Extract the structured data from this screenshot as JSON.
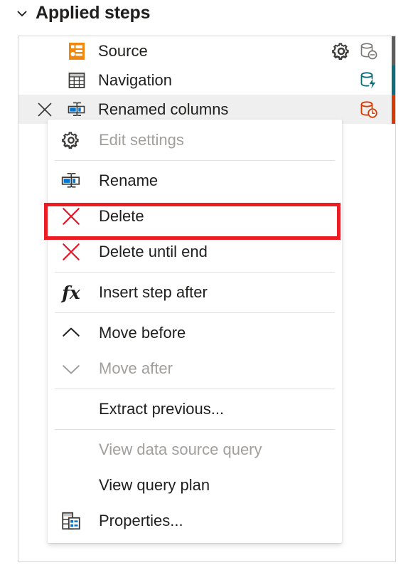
{
  "header": {
    "title": "Applied steps",
    "collapse_icon": "chevron-down-icon",
    "expanded": true
  },
  "steps_panel": {
    "steps": [
      {
        "label": "Source",
        "icon": "source-step-icon",
        "icon_color": "#f2870d",
        "selected": false,
        "has_gear": true,
        "gear_icon": "gear-icon",
        "fold_icon": "folding-not-supported-icon",
        "fold_color": "#797775",
        "fold_bar_color": "#605e5c"
      },
      {
        "label": "Navigation",
        "icon": "navigation-table-icon",
        "icon_color": "#3b3a39",
        "selected": false,
        "has_gear": false,
        "gear_icon": "",
        "fold_icon": "folding-supported-icon",
        "fold_color": "#0f6e7c",
        "fold_bar_color": "#0f6e7c"
      },
      {
        "label": "Renamed columns",
        "icon": "rename-columns-icon",
        "icon_color": "#0078d4",
        "selected": true,
        "has_gear": false,
        "gear_icon": "",
        "fold_icon": "folding-pending-icon",
        "fold_color": "#d83b01",
        "fold_bar_color": "#d83b01",
        "delete_icon": "close-x-icon"
      }
    ]
  },
  "context_menu": {
    "items": [
      {
        "label": "Edit settings",
        "icon": "gear-icon",
        "disabled": true,
        "separator_after": true
      },
      {
        "label": "Rename",
        "icon": "rename-icon",
        "disabled": false,
        "separator_after": false
      },
      {
        "label": "Delete",
        "icon": "delete-x-icon",
        "disabled": false,
        "separator_after": false,
        "highlighted": true
      },
      {
        "label": "Delete until end",
        "icon": "delete-x-icon",
        "disabled": false,
        "separator_after": true
      },
      {
        "label": "Insert step after",
        "icon": "fx-icon",
        "disabled": false,
        "separator_after": true
      },
      {
        "label": "Move before",
        "icon": "chevron-up-icon",
        "disabled": false,
        "separator_after": false
      },
      {
        "label": "Move after",
        "icon": "chevron-down-icon",
        "disabled": true,
        "separator_after": true
      },
      {
        "label": "Extract previous...",
        "icon": "none",
        "disabled": false,
        "separator_after": true
      },
      {
        "label": "View data source query",
        "icon": "none",
        "disabled": true,
        "separator_after": false
      },
      {
        "label": "View query plan",
        "icon": "none",
        "disabled": false,
        "separator_after": false
      },
      {
        "label": "Properties...",
        "icon": "properties-icon",
        "disabled": false,
        "separator_after": false
      }
    ]
  },
  "highlight": {
    "target": "Delete",
    "color": "#ec1c24"
  }
}
